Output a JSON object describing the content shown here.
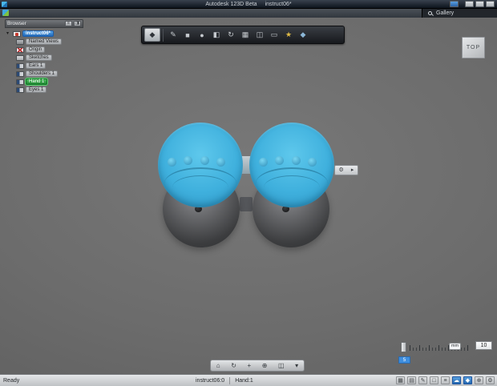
{
  "window": {
    "app_title": "Autodesk 123D Beta",
    "doc_title": "instruct06*"
  },
  "topbar": {
    "gallery_label": "Gallery"
  },
  "browser": {
    "title": "Browser",
    "root": {
      "label": "instruct06*"
    },
    "items": [
      {
        "label": "Named Views"
      },
      {
        "label": "Origin"
      },
      {
        "label": "Sketches"
      },
      {
        "label": "Ears 1"
      },
      {
        "label": "Shoulders 1"
      },
      {
        "label": "Hand 1"
      },
      {
        "label": "Eyes 1"
      }
    ]
  },
  "toolbar": {
    "menu_glyph": "◆",
    "icons": [
      {
        "name": "sketch-tool",
        "glyph": "✎"
      },
      {
        "name": "box-primitive-tool",
        "glyph": "■"
      },
      {
        "name": "sphere-primitive-tool",
        "glyph": "●"
      },
      {
        "name": "extrude-tool",
        "glyph": "◧"
      },
      {
        "name": "revolve-tool",
        "glyph": "↻"
      },
      {
        "name": "pattern-tool",
        "glyph": "▦"
      },
      {
        "name": "combine-tool",
        "glyph": "◫"
      },
      {
        "name": "split-tool",
        "glyph": "▭"
      },
      {
        "name": "material-tool",
        "glyph": "★"
      },
      {
        "name": "effects-tool",
        "glyph": "◆"
      }
    ]
  },
  "viewcube": {
    "face_label": "TOP"
  },
  "mini_toolbar": {
    "gear_glyph": "⚙",
    "arrow_glyph": "▸"
  },
  "nav_toolbar": {
    "icons": [
      {
        "name": "home-view",
        "glyph": "⌂"
      },
      {
        "name": "orbit",
        "glyph": "↻"
      },
      {
        "name": "pan",
        "glyph": "+"
      },
      {
        "name": "zoom",
        "glyph": "⊕"
      },
      {
        "name": "view-modes",
        "glyph": "◫"
      },
      {
        "name": "more",
        "glyph": "▾"
      }
    ]
  },
  "scale_ruler": {
    "unit_label": "mm",
    "value": "10",
    "secondary_value": "5"
  },
  "statusbar": {
    "ready_label": "Ready",
    "doc_ref": "instruct06:0",
    "selection_ref": "Hand:1",
    "icons": [
      {
        "name": "grid-toggle",
        "glyph": "▦"
      },
      {
        "name": "layers-toggle",
        "glyph": "▤"
      },
      {
        "name": "annotate",
        "glyph": "✎"
      },
      {
        "name": "snap-toggle",
        "glyph": "□"
      },
      {
        "name": "list-view",
        "glyph": "≡"
      },
      {
        "name": "cloud-sync",
        "glyph": "☁"
      },
      {
        "name": "share",
        "glyph": "◆"
      },
      {
        "name": "zoom-status",
        "glyph": "⊕"
      },
      {
        "name": "settings",
        "glyph": "⚙"
      }
    ]
  },
  "colors": {
    "selection_blue": "#3fb0dd",
    "highlight_green": "#2f9e42",
    "root_blue": "#2f7fd0"
  }
}
